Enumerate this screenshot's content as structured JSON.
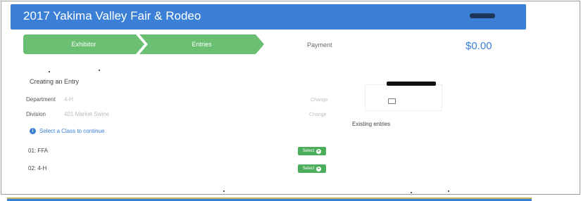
{
  "app": {
    "title": "2017 Yakima Valley Fair & Rodeo"
  },
  "steps": [
    {
      "label": "Exhibitor"
    },
    {
      "label": "Entries"
    },
    {
      "label": "Payment"
    }
  ],
  "cart": {
    "total": "$0.00"
  },
  "form": {
    "heading": "Creating an Entry",
    "department_label": "Department",
    "department_value": "4-H",
    "division_label": "Division",
    "division_value": "401 Market Swine",
    "change_label": "Change",
    "hint": "Select a Class to continue"
  },
  "classes": [
    {
      "name": "01: FFA",
      "button": "Select"
    },
    {
      "name": "02: 4-H",
      "button": "Select"
    }
  ],
  "sidebar": {
    "existing_entries": "Existing entries"
  },
  "colors": {
    "brand_blue": "#3b80d6",
    "step_green": "#6abf73",
    "button_green": "#4cae5b"
  },
  "icons": {
    "info": "info-icon",
    "arrow": "arrow-right-circle-icon",
    "cart": "cart-icon"
  }
}
